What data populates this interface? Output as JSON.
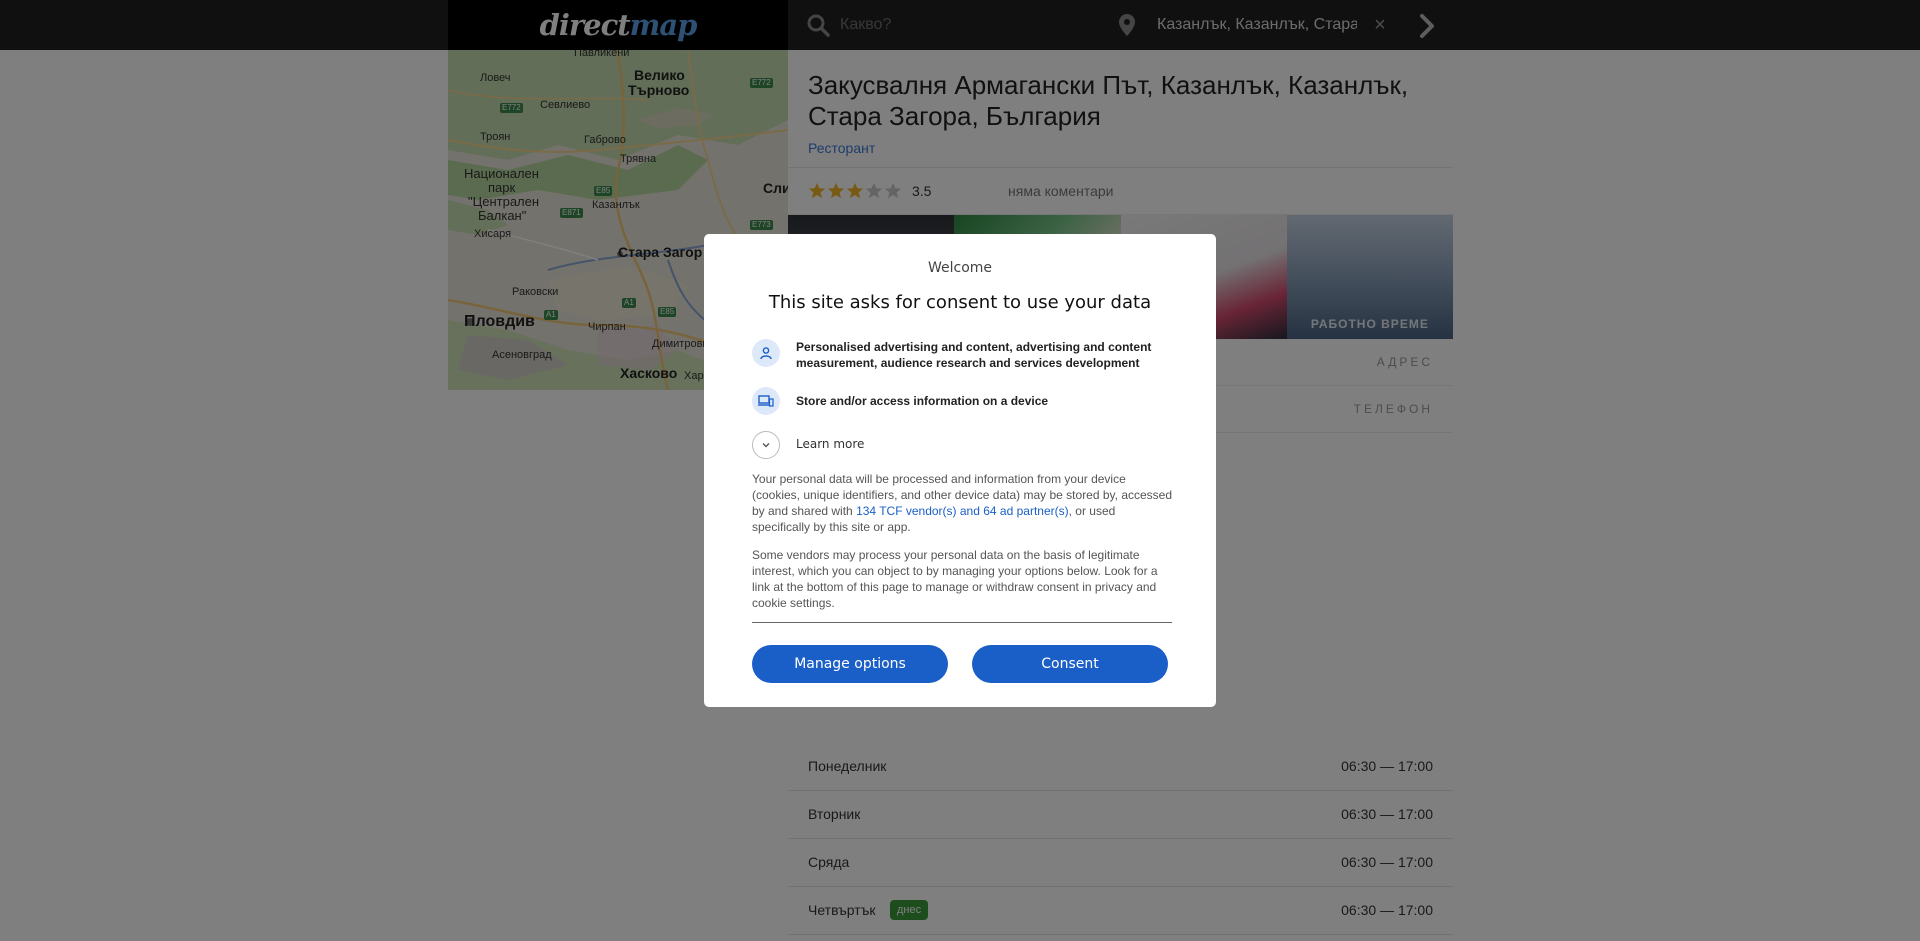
{
  "header": {
    "logo_part1": "direct",
    "logo_part2": "map",
    "search_placeholder": "Какво?",
    "location_value": "Казанлък, Казанлък, Стара Загора",
    "clear_label": "×"
  },
  "map": {
    "labels": {
      "pavlikeni": "Павликени",
      "veliko": "Велико",
      "tarnovo": "Търново",
      "lovech": "Ловеч",
      "sevlievo": "Севлиево",
      "troyan": "Троян",
      "gabrovo": "Габрово",
      "tryavna": "Трявна",
      "park1": "Национален",
      "park2": "парк",
      "park3": "\"Централен",
      "park4": "Балкан\"",
      "hisarya": "Хисаря",
      "kazanlak": "Казанлък",
      "stara_zagora": "Стара Загор",
      "sli": "Сли",
      "rakovski": "Раковски",
      "plovdiv": "Пловдив",
      "chirpan": "Чирпан",
      "dimitrovgrad": "Димитровград",
      "asenovgrad": "Асеновград",
      "haskovo": "Хасково",
      "har": "Хар"
    },
    "roads": {
      "e772a": "E772",
      "e772b": "E772",
      "e85a": "E85",
      "e871": "E871",
      "e773": "E773",
      "a1a": "A1",
      "a1b": "A1",
      "e85b": "E85"
    }
  },
  "place": {
    "title": "Закусвалня Армагански Път, Казанлък, Казанлък, Стара Загора, България",
    "category": "Ресторант",
    "rating": "3.5",
    "rating_fraction": 0.6,
    "comments": "няма коментари",
    "photo_caption": "РАБОТНО ВРЕМЕ",
    "address_label": "АДРЕС",
    "phone_label": "ТЕЛЕФОН"
  },
  "hours": [
    {
      "day": "Понеделник",
      "time": "06:30 — 17:00"
    },
    {
      "day": "Вторник",
      "time": "06:30 — 17:00"
    },
    {
      "day": "Сряда",
      "time": "06:30 — 17:00"
    },
    {
      "day": "Четвъртък",
      "time": "06:30 — 17:00",
      "badge": "днес"
    }
  ],
  "consent": {
    "welcome": "Welcome",
    "title": "This site asks for consent to use your data",
    "purpose1": "Personalised advertising and content, advertising and content measurement, audience research and services development",
    "purpose2": "Store and/or access information on a device",
    "learn_more": "Learn more",
    "body1_pre": "Your personal data will be processed and information from your device (cookies, unique identifiers, and other device data) may be stored by, accessed by and shared with ",
    "vendor_link": "134 TCF vendor(s) and 64 ad partner(s)",
    "body1_post": ", or used specifically by this site or app.",
    "body2": "Some vendors may process your personal data on the basis of legitimate interest, which you can object to by managing your options below. Look for a link at the bottom of this page to manage or withdraw consent in privacy and cookie settings.",
    "manage_button": "Manage options",
    "consent_button": "Consent"
  },
  "colors": {
    "accent": "#1a5fc8",
    "today_badge": "#3a9a3a",
    "star_filled": "#f0b429"
  }
}
